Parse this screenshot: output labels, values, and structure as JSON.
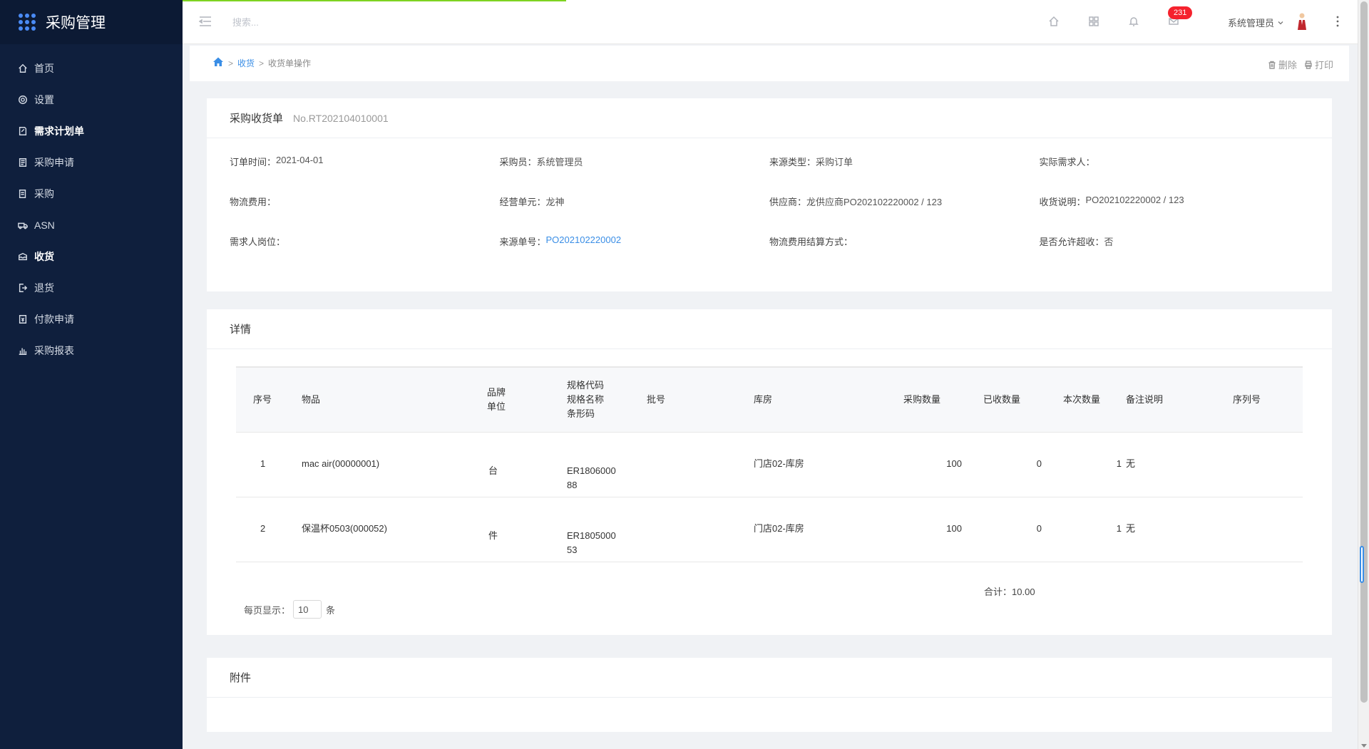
{
  "app": {
    "title": "采购管理"
  },
  "sidebar": {
    "items": [
      {
        "label": "首页",
        "icon": "home-icon"
      },
      {
        "label": "设置",
        "icon": "gear-icon"
      },
      {
        "label": "需求计划单",
        "icon": "doc-edit-icon",
        "active": true
      },
      {
        "label": "采购申请",
        "icon": "doc-icon"
      },
      {
        "label": "采购",
        "icon": "doc-list-icon"
      },
      {
        "label": "ASN",
        "icon": "truck-icon"
      },
      {
        "label": "收货",
        "icon": "box-icon",
        "active": true
      },
      {
        "label": "退货",
        "icon": "exit-icon"
      },
      {
        "label": "付款申请",
        "icon": "money-icon"
      },
      {
        "label": "采购报表",
        "icon": "bar-chart-icon"
      }
    ]
  },
  "topbar": {
    "search_placeholder": "搜索...",
    "badge_count": "231",
    "user_name": "系统管理员"
  },
  "breadcrumb": {
    "items": [
      "收货",
      "收货单操作"
    ],
    "delete_label": "删除",
    "print_label": "打印"
  },
  "header_card": {
    "title": "采购收货单",
    "number": "No.RT202104010001",
    "fields": [
      {
        "label": "订单时间：",
        "value": "2021-04-01"
      },
      {
        "label": "采购员：",
        "value": "系统管理员"
      },
      {
        "label": "来源类型：",
        "value": "采购订单"
      },
      {
        "label": "实际需求人：",
        "value": ""
      },
      {
        "label": "物流费用：",
        "value": ""
      },
      {
        "label": "经营单元：",
        "value": "龙神"
      },
      {
        "label": "供应商：",
        "value": "龙供应商PO202102220002 / 123"
      },
      {
        "label": "收货说明：",
        "value": "PO202102220002 / 123"
      },
      {
        "label": "需求人岗位：",
        "value": ""
      },
      {
        "label": "来源单号：",
        "value": "PO202102220002"
      },
      {
        "label": "物流费用结算方式：",
        "value": ""
      },
      {
        "label": "是否允许超收：",
        "value": "否"
      }
    ]
  },
  "detail_card": {
    "title": "详情",
    "columns": {
      "seq": "序号",
      "item": "物品",
      "brand": "品牌",
      "unit": "单位",
      "spec_code": "规格代码",
      "spec_name": "规格名称",
      "barcode": "条形码",
      "batch": "批号",
      "warehouse": "库房",
      "purchase_qty": "采购数量",
      "received_qty": "已收数量",
      "this_qty": "本次数量",
      "remark": "备注说明",
      "serial": "序列号"
    },
    "rows": [
      {
        "seq": "1",
        "item": "mac air(00000001)",
        "unit": "台",
        "code_line1": "ER1806000",
        "code_line2": "88",
        "warehouse": "门店02-库房",
        "purchase_qty": "100",
        "received_qty": "0",
        "this_qty": "1",
        "remark": "无"
      },
      {
        "seq": "2",
        "item": "保温杯0503(000052)",
        "unit": "件",
        "code_line1": "ER1805000",
        "code_line2": "53",
        "warehouse": "门店02-库房",
        "purchase_qty": "100",
        "received_qty": "0",
        "this_qty": "1",
        "remark": "无"
      }
    ],
    "total_label": "合计：",
    "total_value": "10.00",
    "page_size_label": "每页显示：",
    "page_size": "10",
    "page_size_unit": "条"
  },
  "attachment_card": {
    "title": "附件"
  },
  "colors": {
    "sidebar_bg": "#0f1f3d",
    "accent": "#3a8ee6",
    "badge": "#f5222d",
    "progress": "#7ed321"
  }
}
